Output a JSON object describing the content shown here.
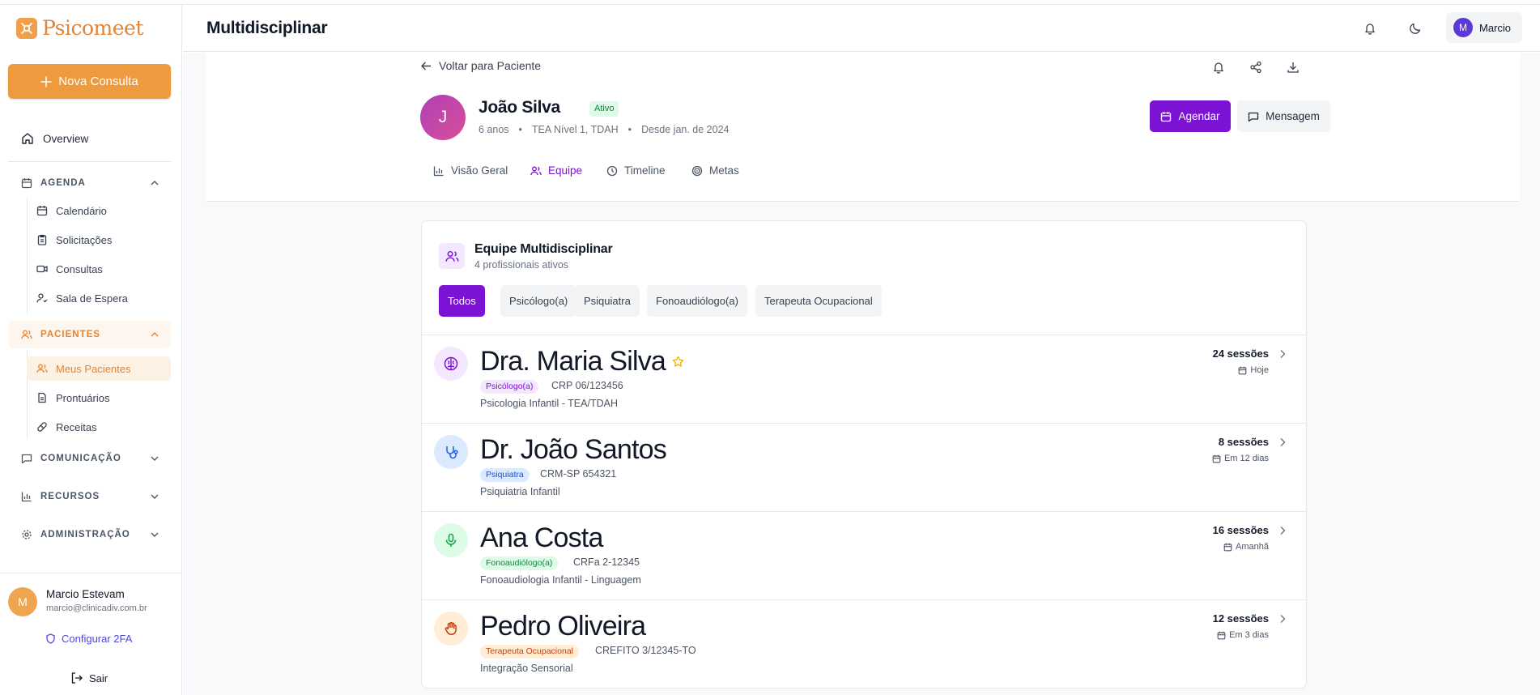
{
  "app": {
    "brand": "Psicomeet",
    "header_title": "Multidisciplinar"
  },
  "sidebar": {
    "new_button": "Nova Consulta",
    "overview": "Overview",
    "groups": {
      "agenda": {
        "label": "AGENDA",
        "items": [
          "Calendário",
          "Solicitações",
          "Consultas",
          "Sala de Espera"
        ]
      },
      "pacientes": {
        "label": "PACIENTES",
        "items": [
          "Meus Pacientes",
          "Prontuários",
          "Receitas"
        ]
      },
      "comunicacao": {
        "label": "COMUNICAÇÃO"
      },
      "recursos": {
        "label": "RECURSOS"
      },
      "administracao": {
        "label": "ADMINISTRAÇÃO"
      }
    },
    "user": {
      "initial": "M",
      "name": "Marcio Estevam",
      "email": "marcio@clinicadiv.com.br",
      "twofa": "Configurar 2FA",
      "logout": "Sair"
    }
  },
  "header": {
    "user_initial": "M",
    "user_name": "Marcio"
  },
  "patient": {
    "back_label": "Voltar para Paciente",
    "initial": "J",
    "name": "João Silva",
    "status": "Ativo",
    "age": "6 anos",
    "diagnosis": "TEA Nível 1, TDAH",
    "since": "Desde jan. de 2024",
    "schedule_button": "Agendar",
    "message_button": "Mensagem",
    "tabs": [
      "Visão Geral",
      "Equipe",
      "Timeline",
      "Metas"
    ]
  },
  "team": {
    "title": "Equipe Multidisciplinar",
    "subtitle": "4 profissionais ativos",
    "filters": [
      "Todos",
      "Psicólogo(a)",
      "Psiquiatra",
      "Fonoaudiólogo(a)",
      "Terapeuta Ocupacional"
    ],
    "members": [
      {
        "name": "Dra. Maria Silva",
        "role": "Psicólogo(a)",
        "registry": "CRP 06/123456",
        "specialty": "Psicologia Infantil - TEA/TDAH",
        "sessions": "24 sessões",
        "next": "Hoje",
        "starred": true,
        "icon": "brain-icon",
        "color": "#7c12d4",
        "bg": "#f3e8ff"
      },
      {
        "name": "Dr. João Santos",
        "role": "Psiquiatra",
        "registry": "CRM-SP 654321",
        "specialty": "Psiquiatria Infantil",
        "sessions": "8 sessões",
        "next": "Em 12 dias",
        "starred": false,
        "icon": "stethoscope-icon",
        "color": "#2563eb",
        "bg": "#dbeafe"
      },
      {
        "name": "Ana Costa",
        "role": "Fonoaudiólogo(a)",
        "registry": "CRFa 2-12345",
        "specialty": "Fonoaudiologia Infantil - Linguagem",
        "sessions": "16 sessões",
        "next": "Amanhã",
        "starred": false,
        "icon": "microphone-icon",
        "color": "#16a34a",
        "bg": "#dcfce7"
      },
      {
        "name": "Pedro Oliveira",
        "role": "Terapeuta Ocupacional",
        "registry": "CREFITO 3/12345-TO",
        "specialty": "Integração Sensorial",
        "sessions": "12 sessões",
        "next": "Em 3 dias",
        "starred": false,
        "icon": "hand-icon",
        "color": "#c2410c",
        "bg": "#ffedd5"
      }
    ]
  }
}
